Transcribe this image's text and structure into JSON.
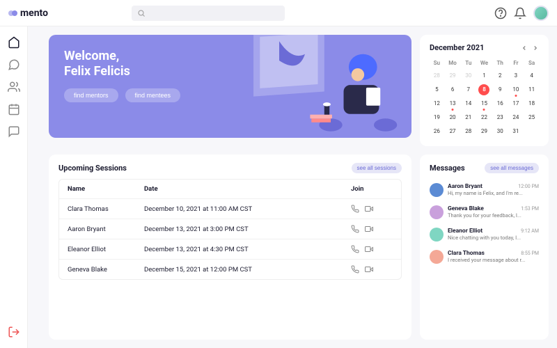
{
  "brand": "mento",
  "hero": {
    "greeting": "Welcome,",
    "name": "Felix Felicis",
    "find_mentors": "find mentors",
    "find_mentees": "find mentees"
  },
  "calendar": {
    "title": "December 2021",
    "dow": [
      "Su",
      "Mo",
      "Tu",
      "We",
      "Th",
      "Fr",
      "Sa"
    ],
    "leading_muted": [
      28,
      29,
      30
    ],
    "days": [
      1,
      2,
      3,
      4,
      5,
      6,
      7,
      8,
      9,
      10,
      11,
      12,
      13,
      14,
      15,
      16,
      17,
      18,
      19,
      20,
      21,
      22,
      23,
      24,
      25,
      26,
      27,
      28,
      29,
      30,
      31
    ],
    "selected": 8,
    "dotted": [
      10,
      13,
      15
    ]
  },
  "sessions": {
    "title": "Upcoming Sessions",
    "see_all": "see all sessions",
    "cols": {
      "name": "Name",
      "date": "Date",
      "join": "Join"
    },
    "rows": [
      {
        "name": "Clara Thomas",
        "date": "December 10, 2021 at 11:00 AM CST"
      },
      {
        "name": "Aaron Bryant",
        "date": "December 13, 2021 at 3:00 PM CST"
      },
      {
        "name": "Eleanor Elliot",
        "date": "December 13, 2021 at 4:30 PM CST"
      },
      {
        "name": "Geneva Blake",
        "date": "December 15, 2021 at 12:00 PM CST"
      }
    ]
  },
  "messages": {
    "title": "Messages",
    "see_all": "see all messages",
    "items": [
      {
        "name": "Aaron Bryant",
        "time": "12:00 PM",
        "text": "Hi, my name is Felix, and I'm re...",
        "color": "#5b8bd4"
      },
      {
        "name": "Geneva Blake",
        "time": "1:53 PM",
        "text": "Thank you for your feedback, I...",
        "color": "#c9a0dc"
      },
      {
        "name": "Eleanor Elliot",
        "time": "9:12 AM",
        "text": "Nice chatting with you today, I...",
        "color": "#7fd6c2"
      },
      {
        "name": "Clara Thomas",
        "time": "8:55 PM",
        "text": "I received your message about r...",
        "color": "#f4a896"
      }
    ]
  }
}
